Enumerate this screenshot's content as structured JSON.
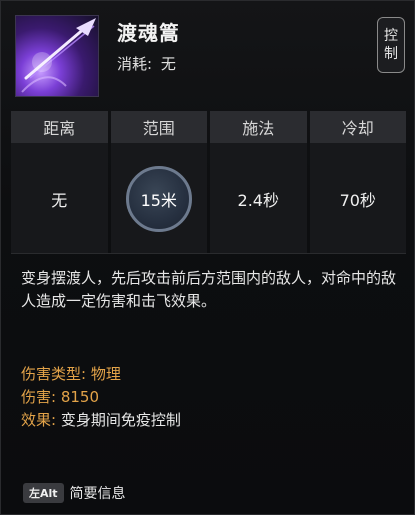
{
  "skill": {
    "name": "渡魂篙",
    "cost_label": "消耗:",
    "cost_value": "无",
    "tag_chars": [
      "控",
      "制"
    ],
    "icon": "ferry-pole-purple-skill-icon"
  },
  "stats": {
    "headers": [
      "距离",
      "范围",
      "施法",
      "冷却"
    ],
    "values": [
      "无",
      "15米",
      "2.4秒",
      "70秒"
    ]
  },
  "description": "变身摆渡人，先后攻击前后方范围内的敌人，对命中的敌人造成一定伤害和击飞效果。",
  "attributes": {
    "damage_type_label": "伤害类型:",
    "damage_type_value": "物理",
    "damage_label": "伤害:",
    "damage_value": "8150",
    "effect_label": "效果:",
    "effect_value": "变身期间免疫控制"
  },
  "footer": {
    "key": "左Alt",
    "label": "简要信息"
  },
  "colors": {
    "gold": "#e3a349",
    "accent_circle": "#6d7a8e"
  }
}
